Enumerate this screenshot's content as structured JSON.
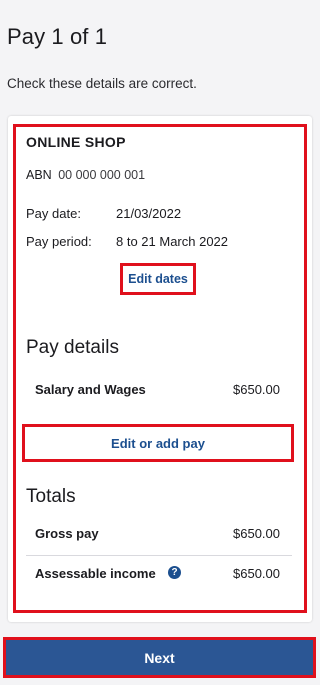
{
  "page": {
    "title": "Pay 1 of 1",
    "subtitle": "Check these details are correct."
  },
  "business": {
    "name": "ONLINE SHOP",
    "abn_label": "ABN",
    "abn_value": "00 000 000 001"
  },
  "pay_info": {
    "pay_date_label": "Pay date:",
    "pay_date_value": "21/03/2022",
    "pay_period_label": "Pay period:",
    "pay_period_value": "8 to 21 March 2022",
    "edit_dates_label": "Edit dates"
  },
  "pay_details": {
    "heading": "Pay details",
    "items": [
      {
        "label": "Salary and Wages",
        "value": "$650.00"
      }
    ],
    "edit_button_label": "Edit or add pay"
  },
  "totals": {
    "heading": "Totals",
    "gross_label": "Gross pay",
    "gross_value": "$650.00",
    "assessable_label": "Assessable income",
    "assessable_value": "$650.00",
    "help_icon": "question-circle-icon",
    "help_glyph": "?"
  },
  "footer": {
    "next_label": "Next"
  },
  "colors": {
    "accent": "#2b5694",
    "link": "#1c4f8f",
    "highlight": "#e0101c"
  }
}
